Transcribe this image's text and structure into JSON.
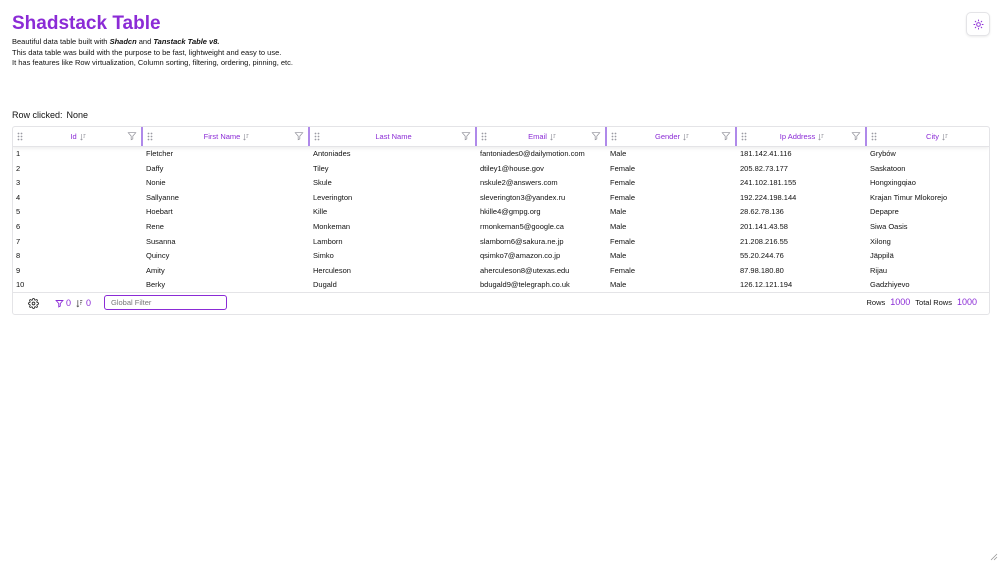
{
  "header": {
    "title": "Shadstack Table",
    "theme_icon": "sun-icon"
  },
  "description": {
    "line1_pre": "Beautiful data table built with ",
    "line1_shadcn": "Shadcn",
    "line1_and": " and ",
    "line1_tanstack": "Tanstack Table v8.",
    "line2": "This data table was build with the purpose to be fast, lightweight and easy to use.",
    "line3": "It has features like Row virtualization, Column sorting, filtering, ordering, pinning, etc."
  },
  "row_clicked": {
    "label": "Row clicked:",
    "value": "None"
  },
  "table": {
    "columns": [
      {
        "label": "Id",
        "sortable": true
      },
      {
        "label": "First Name",
        "sortable": true
      },
      {
        "label": "Last Name",
        "sortable": false
      },
      {
        "label": "Email",
        "sortable": true
      },
      {
        "label": "Gender",
        "sortable": true
      },
      {
        "label": "Ip Address",
        "sortable": true
      },
      {
        "label": "City",
        "sortable": true
      }
    ],
    "rows": [
      [
        "1",
        "Fletcher",
        "Antoniades",
        "fantoniades0@dailymotion.com",
        "Male",
        "181.142.41.116",
        "Grybów"
      ],
      [
        "2",
        "Daffy",
        "Tiley",
        "dtiley1@house.gov",
        "Female",
        "205.82.73.177",
        "Saskatoon"
      ],
      [
        "3",
        "Nonie",
        "Skule",
        "nskule2@answers.com",
        "Female",
        "241.102.181.155",
        "Hongxingqiao"
      ],
      [
        "4",
        "Sallyanne",
        "Leverington",
        "sleverington3@yandex.ru",
        "Female",
        "192.224.198.144",
        "Krajan Timur Mlokorejo"
      ],
      [
        "5",
        "Hoebart",
        "Kille",
        "hkille4@gmpg.org",
        "Male",
        "28.62.78.136",
        "Depapre"
      ],
      [
        "6",
        "Rene",
        "Monkeman",
        "rmonkeman5@google.ca",
        "Male",
        "201.141.43.58",
        "Siwa Oasis"
      ],
      [
        "7",
        "Susanna",
        "Lamborn",
        "slamborn6@sakura.ne.jp",
        "Female",
        "21.208.216.55",
        "Xilong"
      ],
      [
        "8",
        "Quincy",
        "Simko",
        "qsimko7@amazon.co.jp",
        "Male",
        "55.20.244.76",
        "Jäppilä"
      ],
      [
        "9",
        "Amity",
        "Herculeson",
        "aherculeson8@utexas.edu",
        "Female",
        "87.98.180.80",
        "Rijau"
      ],
      [
        "10",
        "Berky",
        "Dugald",
        "bdugald9@telegraph.co.uk",
        "Male",
        "126.12.121.194",
        "Gadzhiyevo"
      ]
    ]
  },
  "footer": {
    "settings_icon": "gear-icon",
    "filter_count": "0",
    "sort_count": "0",
    "global_filter_placeholder": "Global Filter",
    "rows_label": "Rows",
    "rows_value": "1000",
    "total_rows_label": "Total Rows",
    "total_rows_value": "1000"
  },
  "colors": {
    "accent": "#8b2bd6",
    "border": "#e4e4e7",
    "text": "#111111"
  }
}
